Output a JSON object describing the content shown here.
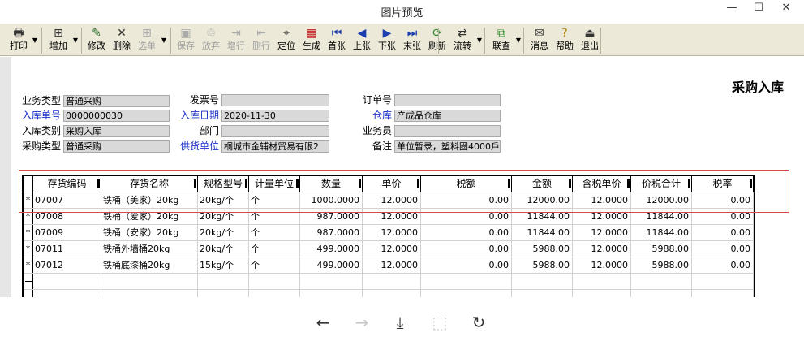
{
  "window": {
    "title": "图片预览",
    "minimize": "—",
    "maximize": "☐",
    "close": "✕"
  },
  "toolbar": [
    {
      "label": "打印",
      "icon": "🖶",
      "enabled": true
    },
    {
      "label": "增加",
      "icon": "⊞",
      "enabled": true
    },
    {
      "label": "修改",
      "icon": "✎",
      "enabled": true
    },
    {
      "label": "删除",
      "icon": "✕",
      "enabled": true
    },
    {
      "label": "选单",
      "icon": "⊞",
      "enabled": false
    },
    {
      "label": "保存",
      "icon": "▣",
      "enabled": false
    },
    {
      "label": "放弃",
      "icon": "♲",
      "enabled": false
    },
    {
      "label": "增行",
      "icon": "⇥",
      "enabled": false
    },
    {
      "label": "删行",
      "icon": "⇤",
      "enabled": false
    },
    {
      "label": "定位",
      "icon": "⌖",
      "enabled": true
    },
    {
      "label": "生成",
      "icon": "▦",
      "enabled": true
    },
    {
      "label": "首张",
      "icon": "⏮",
      "enabled": true
    },
    {
      "label": "上张",
      "icon": "◀",
      "enabled": true
    },
    {
      "label": "下张",
      "icon": "▶",
      "enabled": true
    },
    {
      "label": "末张",
      "icon": "⏭",
      "enabled": true
    },
    {
      "label": "刷新",
      "icon": "⟳",
      "enabled": true
    },
    {
      "label": "流转",
      "icon": "⇄",
      "enabled": true
    },
    {
      "label": "联查",
      "icon": "⧉",
      "enabled": true
    },
    {
      "label": "消息",
      "icon": "✉",
      "enabled": true
    },
    {
      "label": "帮助",
      "icon": "?",
      "enabled": true
    },
    {
      "label": "退出",
      "icon": "⏏",
      "enabled": true
    }
  ],
  "document": {
    "title": "采购入库",
    "header": {
      "business_type_label": "业务类型",
      "business_type_value": "普通采购",
      "inbound_no_label": "入库单号",
      "inbound_no_value": "0000000030",
      "inbound_category_label": "入库类别",
      "inbound_category_value": "采购入库",
      "purchase_type_label": "采购类型",
      "purchase_type_value": "普通采购",
      "invoice_no_label": "发票号",
      "invoice_no_value": "",
      "inbound_date_label": "入库日期",
      "inbound_date_value": "2020-11-30",
      "department_label": "部门",
      "department_value": "",
      "supplier_label": "供货单位",
      "supplier_value": "桐城市金辅材贸易有限2",
      "order_no_label": "订单号",
      "order_no_value": "",
      "warehouse_label": "仓库",
      "warehouse_value": "产成品仓库",
      "salesman_label": "业务员",
      "salesman_value": "",
      "remark_label": "备注",
      "remark_value": "单位暂录，塑料圈4000戶"
    },
    "columns": [
      "存货编码",
      "存货名称",
      "规格型号",
      "计量单位",
      "数量",
      "单价",
      "税额",
      "金额",
      "含税单价",
      "价税合计",
      "税率"
    ],
    "rows": [
      {
        "mark": "*",
        "code": "07007",
        "name": "铁桶（美家）20kg",
        "spec": "20kg/个",
        "unit": "个",
        "qty": "1000.0000",
        "price": "12.0000",
        "tax": "0.00",
        "amount": "12000.00",
        "tax_price": "12.0000",
        "total": "12000.00",
        "rate": "0.00"
      },
      {
        "mark": "*",
        "code": "07008",
        "name": "铁桶（爱家）20kg",
        "spec": "20kg/个",
        "unit": "个",
        "qty": "987.0000",
        "price": "12.0000",
        "tax": "0.00",
        "amount": "11844.00",
        "tax_price": "12.0000",
        "total": "11844.00",
        "rate": "0.00"
      },
      {
        "mark": "*",
        "code": "07009",
        "name": "铁桶（安家）20kg",
        "spec": "20kg/个",
        "unit": "个",
        "qty": "987.0000",
        "price": "12.0000",
        "tax": "0.00",
        "amount": "11844.00",
        "tax_price": "12.0000",
        "total": "11844.00",
        "rate": "0.00"
      },
      {
        "mark": "*",
        "code": "07011",
        "name": "铁桶外墙桶20kg",
        "spec": "20kg/个",
        "unit": "个",
        "qty": "499.0000",
        "price": "12.0000",
        "tax": "0.00",
        "amount": "5988.00",
        "tax_price": "12.0000",
        "total": "5988.00",
        "rate": "0.00"
      },
      {
        "mark": "*",
        "code": "07012",
        "name": "铁桶底漆桶20kg",
        "spec": "15kg/个",
        "unit": "个",
        "qty": "499.0000",
        "price": "12.0000",
        "tax": "0.00",
        "amount": "5988.00",
        "tax_price": "12.0000",
        "total": "5988.00",
        "rate": "0.00"
      }
    ]
  },
  "viewer_bar": [
    {
      "icon": "arrow-left-icon",
      "glyph": "←",
      "enabled": true
    },
    {
      "icon": "arrow-right-icon",
      "glyph": "→",
      "enabled": false
    },
    {
      "icon": "download-icon",
      "glyph": "⤓",
      "enabled": true
    },
    {
      "icon": "fit-screen-icon",
      "glyph": "⬚",
      "enabled": false
    },
    {
      "icon": "rotate-icon",
      "glyph": "↻",
      "enabled": true
    }
  ],
  "colors": {
    "accent_label": "#1a2fc8",
    "highlight_border": "#d84848",
    "toolbar_bg": "#ece9d8"
  }
}
